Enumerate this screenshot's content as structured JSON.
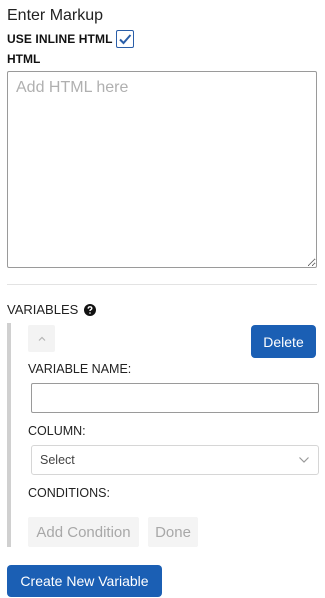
{
  "form": {
    "title": "Enter Markup",
    "use_inline_label": "USE INLINE HTML",
    "use_inline_checked": true,
    "html_label": "HTML",
    "html_placeholder": "Add HTML here",
    "html_value": ""
  },
  "variables": {
    "section_label": "VARIABLES",
    "help_icon": "question-circle-icon",
    "item": {
      "collapse_icon": "chevron-up-icon",
      "delete_label": "Delete",
      "name_label": "VARIABLE NAME:",
      "name_value": "",
      "column_label": "COLUMN:",
      "column_selected": "Select",
      "conditions_label": "CONDITIONS:",
      "add_condition_label": "Add Condition",
      "done_label": "Done"
    },
    "create_label": "Create New Variable"
  },
  "colors": {
    "primary_button": "#1b5fb4",
    "checkbox_check": "#2a5ea8"
  }
}
